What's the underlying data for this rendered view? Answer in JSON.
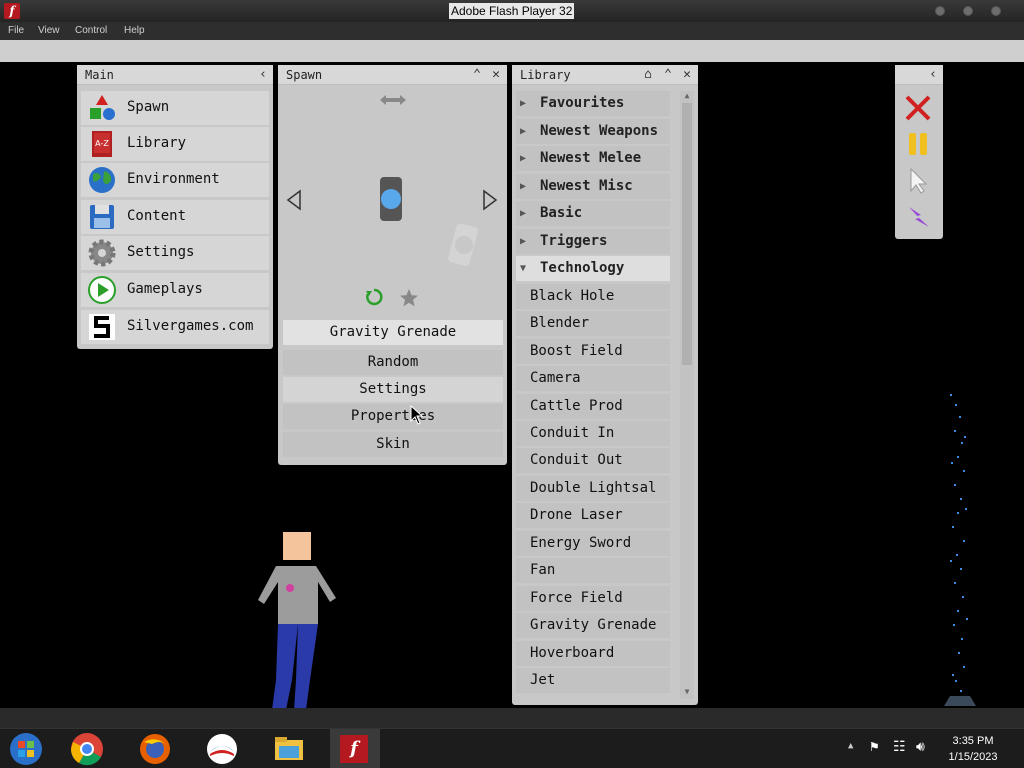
{
  "window": {
    "title": "Adobe Flash Player 32"
  },
  "menu": [
    "File",
    "View",
    "Control",
    "Help"
  ],
  "main_panel": {
    "title": "Main",
    "items": [
      {
        "label": "Spawn",
        "icon": "spawn-shapes-icon"
      },
      {
        "label": "Library",
        "icon": "library-book-icon"
      },
      {
        "label": "Environment",
        "icon": "globe-icon"
      },
      {
        "label": "Content",
        "icon": "floppy-disk-icon"
      },
      {
        "label": "Settings",
        "icon": "gear-icon"
      },
      {
        "label": "Gameplays",
        "icon": "play-icon"
      },
      {
        "label": "Silvergames.com",
        "icon": "silvergames-logo-icon"
      }
    ]
  },
  "spawn_panel": {
    "title": "Spawn",
    "selected_item": "Gravity Grenade",
    "options": [
      "Random",
      "Settings",
      "Properties",
      "Skin"
    ]
  },
  "library_panel": {
    "title": "Library",
    "categories": [
      "Favourites",
      "Newest Weapons",
      "Newest Melee",
      "Newest Misc",
      "Basic",
      "Triggers",
      "Technology"
    ],
    "items": [
      "Black Hole",
      "Blender",
      "Boost Field",
      "Camera",
      "Cattle Prod",
      "Conduit In",
      "Conduit Out",
      "Double Lightsal",
      "Drone Laser",
      "Energy Sword",
      "Fan",
      "Force Field",
      "Gravity Grenade",
      "Hoverboard",
      "Jet"
    ]
  },
  "taskbar": {
    "time": "3:35 PM",
    "date": "1/15/2023"
  },
  "colors": {
    "panel_bg": "#c8c8c8",
    "close_red": "#d02020",
    "pause_yellow": "#f0c020",
    "lightning_purple": "#9a4ad8"
  }
}
